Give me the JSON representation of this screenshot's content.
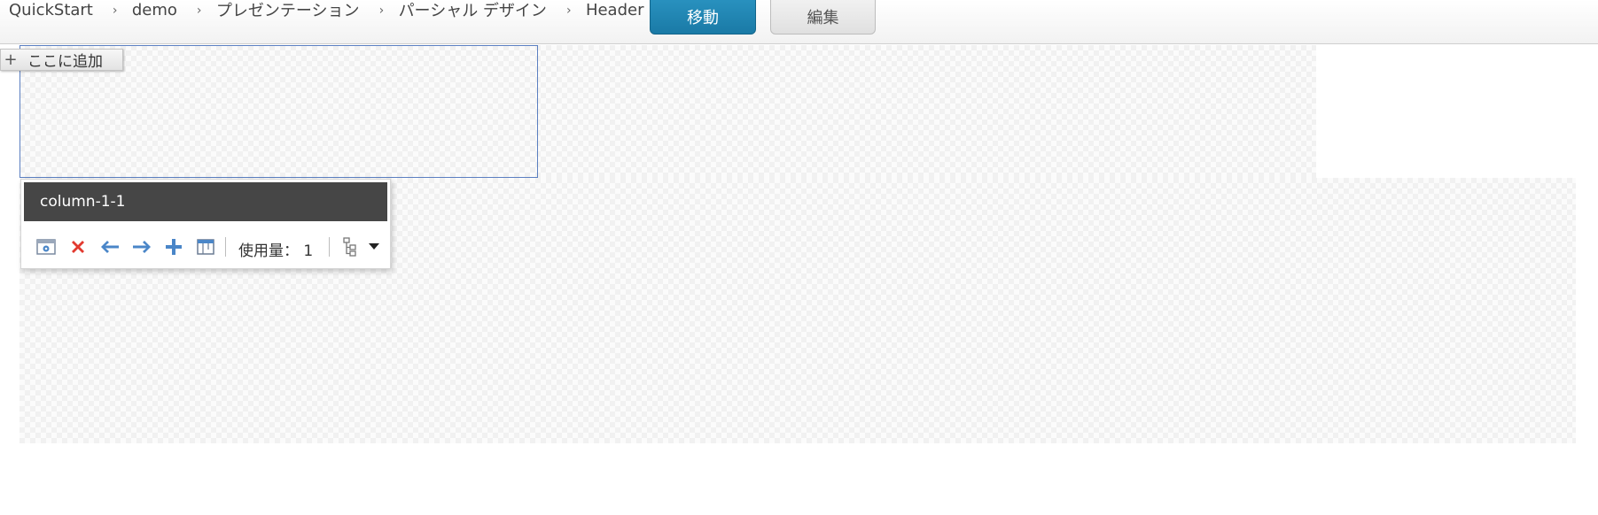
{
  "breadcrumb": {
    "items": [
      "QuickStart",
      "demo",
      "プレゼンテーション",
      "パーシャル デザイン",
      "Header"
    ]
  },
  "toolbar": {
    "move_label": "移動",
    "edit_label": "編集"
  },
  "add_here": {
    "label": "ここに追加",
    "icon": "plus-icon"
  },
  "panel": {
    "title": "column-1-1",
    "usage_label": "使用量：",
    "usage_value": "1",
    "tools": [
      "settings-icon",
      "delete-icon",
      "arrow-left-icon",
      "arrow-right-icon",
      "add-icon",
      "layout-icon",
      "tree-icon",
      "caret-down-icon"
    ]
  },
  "colors": {
    "primary_button": "#1f86b4",
    "panel_header": "#464646",
    "delete_red": "#e23a2f",
    "icon_blue": "#4a86c8",
    "selection_border": "#5b7fc1"
  }
}
